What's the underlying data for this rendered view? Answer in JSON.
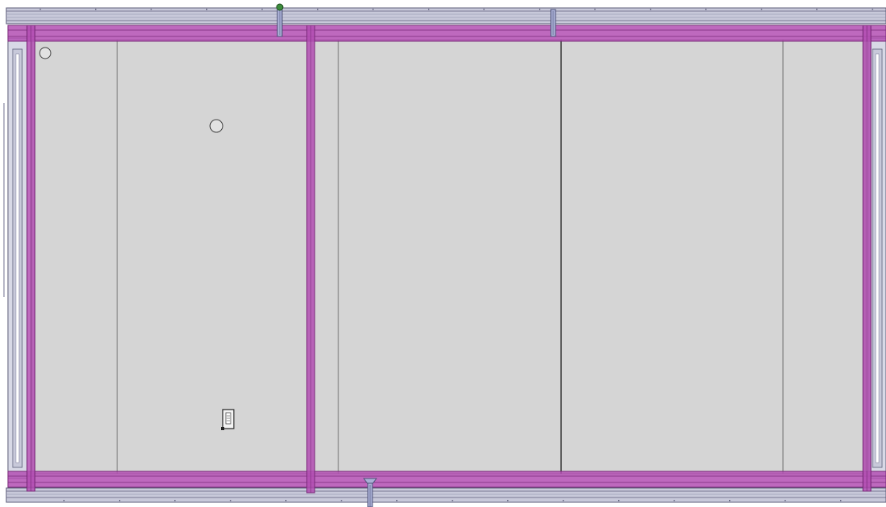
{
  "colors": {
    "background": "#ffffff",
    "panel_fill": "#d5d5d5",
    "panel_seam": "#6e6e6e",
    "frame_magenta": "#b34fb3",
    "frame_magenta_dark": "#7a2a7a",
    "rail_fill": "#c8c9da",
    "rail_stroke": "#5c5d78",
    "bracket_fill": "#aab0d6",
    "node_green": "#3c8c3c"
  },
  "scene": {
    "panels_left_section": 2,
    "panels_right_section": 3,
    "round_holes": 2,
    "switch_boxes": 1,
    "top_brackets": 2,
    "bottom_brackets": 1
  }
}
